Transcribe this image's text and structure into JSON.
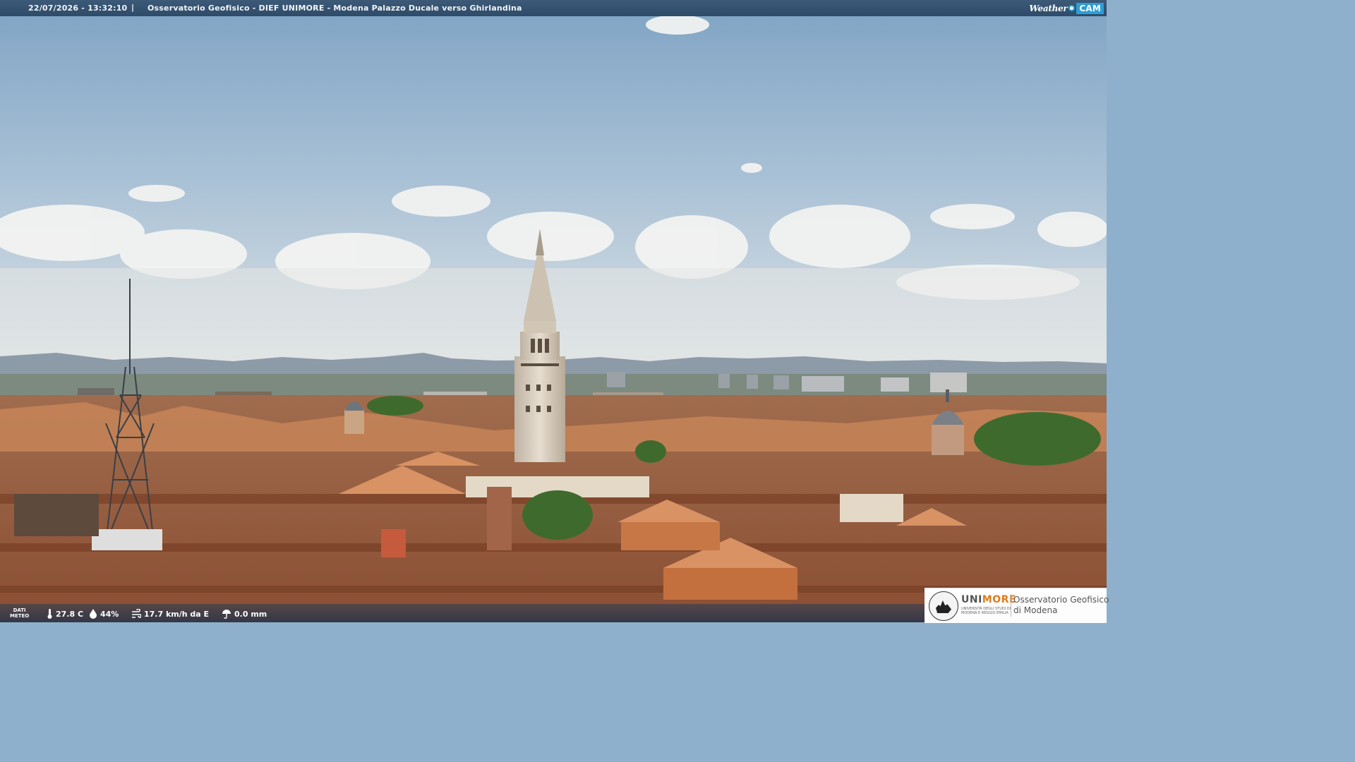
{
  "overlay": {
    "timestamp": "22/07/2026 - 13:32:10",
    "separator": "|",
    "caption": "Osservatorio Geofisico - DIEF UNIMORE - Modena Palazzo Ducale verso Ghirlandina",
    "brand_weather": "Weather",
    "brand_cam": "CAM"
  },
  "weather": {
    "dati_line1": "DATI",
    "dati_line2": "METEO",
    "temperature": "27.8 C",
    "humidity": "44%",
    "wind": "17.7 km/h da E",
    "rain": "0.0 mm"
  },
  "logo": {
    "uni_prefix": "UNI",
    "uni_suffix": "MORE",
    "uni_sub_1": "UNIVERSITÀ DEGLI STUDI DI",
    "uni_sub_2": "MODENA E REGGIO EMILIA",
    "observatory_line1": "Osservatorio Geofisico",
    "observatory_line2": "di Modena"
  },
  "colors": {
    "sky_top": "#7fa3c4",
    "sky_bottom": "#dde3e6",
    "mountains": "#8a97a5",
    "roofs": "#b06a45",
    "tower": "#d9cfc2",
    "brand_blue": "#2c9fd6",
    "uni_orange": "#e07b1a"
  }
}
